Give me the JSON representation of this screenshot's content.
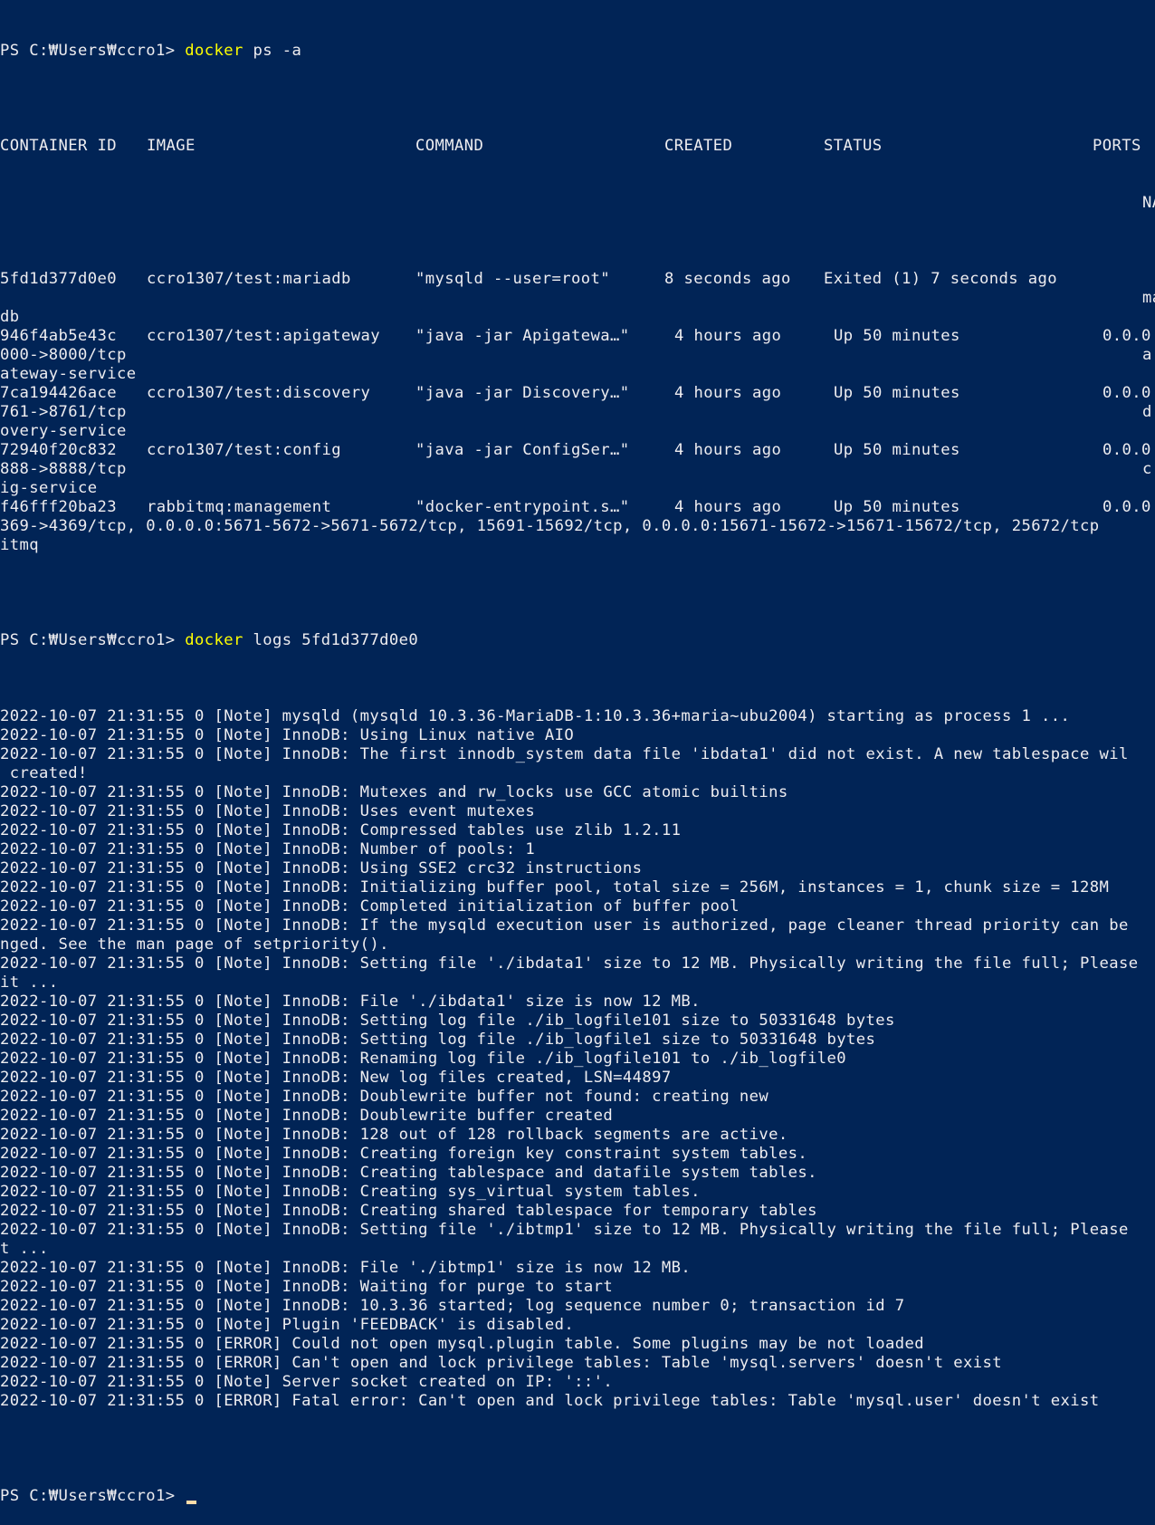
{
  "window": {
    "app": "Windows PowerShell",
    "colors": {
      "background": "#012456",
      "text": "#eeedf0",
      "command": "#ffff00",
      "cursor": "#fedba9"
    }
  },
  "prompt": "PS C:₩Users₩ccro1> ",
  "prev_command": {
    "prefix": "PS C:₩Users₩ccro1> ",
    "cmd": "docker",
    "args": " ps -a"
  },
  "docker_ps": {
    "headers": {
      "container_id": "CONTAINER ID",
      "image": "IMAGE",
      "command": "COMMAND",
      "created": "CREATED",
      "status": "STATUS",
      "ports": "PORTS",
      "names_partial": "NA"
    },
    "rows": [
      {
        "container_id": "5fd1d377d0e0",
        "image": "ccro1307/test:mariadb",
        "command": "\"mysqld --user=root\"",
        "created": "8 seconds ago",
        "status": "Exited (1) 7 seconds ago",
        "ports_partial": "",
        "wrap1": "",
        "wrap1_right": "ma",
        "wrap2": "db"
      },
      {
        "container_id": "946f4ab5e43c",
        "image": "ccro1307/test:apigateway",
        "command": "\"java -jar Apigatewa…\"",
        "created": "4 hours ago",
        "status": "Up 50 minutes",
        "ports_partial": "0.0.0",
        "wrap1": "000->8000/tcp",
        "wrap1_right": "a",
        "wrap2": "ateway-service"
      },
      {
        "container_id": "7ca194426ace",
        "image": "ccro1307/test:discovery",
        "command": "\"java -jar Discovery…\"",
        "created": "4 hours ago",
        "status": "Up 50 minutes",
        "ports_partial": "0.0.0",
        "wrap1": "761->8761/tcp",
        "wrap1_right": "d",
        "wrap2": "overy-service"
      },
      {
        "container_id": "72940f20c832",
        "image": "ccro1307/test:config",
        "command": "\"java -jar ConfigSer…\"",
        "created": "4 hours ago",
        "status": "Up 50 minutes",
        "ports_partial": "0.0.0",
        "wrap1": "888->8888/tcp",
        "wrap1_right": "c",
        "wrap2": "ig-service"
      },
      {
        "container_id": "f46fff20ba23",
        "image": "rabbitmq:management",
        "command": "\"docker-entrypoint.s…\"",
        "created": "4 hours ago",
        "status": "Up 50 minutes",
        "ports_partial": "0.0.0",
        "wrap1": "369->4369/tcp, 0.0.0.0:5671-5672->5671-5672/tcp, 15691-15692/tcp, 0.0.0.0:15671-15672->15671-15672/tcp, 25672/tcp",
        "wrap1_right": "",
        "wrap2": "itmq"
      }
    ]
  },
  "logs_command": {
    "prefix": "PS C:₩Users₩ccro1> ",
    "cmd": "docker",
    "args": " logs 5fd1d377d0e0"
  },
  "log_lines": [
    "2022-10-07 21:31:55 0 [Note] mysqld (mysqld 10.3.36-MariaDB-1:10.3.36+maria~ubu2004) starting as process 1 ...",
    "2022-10-07 21:31:55 0 [Note] InnoDB: Using Linux native AIO",
    "2022-10-07 21:31:55 0 [Note] InnoDB: The first innodb_system data file 'ibdata1' did not exist. A new tablespace wil",
    " created!",
    "2022-10-07 21:31:55 0 [Note] InnoDB: Mutexes and rw_locks use GCC atomic builtins",
    "2022-10-07 21:31:55 0 [Note] InnoDB: Uses event mutexes",
    "2022-10-07 21:31:55 0 [Note] InnoDB: Compressed tables use zlib 1.2.11",
    "2022-10-07 21:31:55 0 [Note] InnoDB: Number of pools: 1",
    "2022-10-07 21:31:55 0 [Note] InnoDB: Using SSE2 crc32 instructions",
    "2022-10-07 21:31:55 0 [Note] InnoDB: Initializing buffer pool, total size = 256M, instances = 1, chunk size = 128M",
    "2022-10-07 21:31:55 0 [Note] InnoDB: Completed initialization of buffer pool",
    "2022-10-07 21:31:55 0 [Note] InnoDB: If the mysqld execution user is authorized, page cleaner thread priority can be",
    "nged. See the man page of setpriority().",
    "2022-10-07 21:31:55 0 [Note] InnoDB: Setting file './ibdata1' size to 12 MB. Physically writing the file full; Please",
    "it ...",
    "2022-10-07 21:31:55 0 [Note] InnoDB: File './ibdata1' size is now 12 MB.",
    "2022-10-07 21:31:55 0 [Note] InnoDB: Setting log file ./ib_logfile101 size to 50331648 bytes",
    "2022-10-07 21:31:55 0 [Note] InnoDB: Setting log file ./ib_logfile1 size to 50331648 bytes",
    "2022-10-07 21:31:55 0 [Note] InnoDB: Renaming log file ./ib_logfile101 to ./ib_logfile0",
    "2022-10-07 21:31:55 0 [Note] InnoDB: New log files created, LSN=44897",
    "2022-10-07 21:31:55 0 [Note] InnoDB: Doublewrite buffer not found: creating new",
    "2022-10-07 21:31:55 0 [Note] InnoDB: Doublewrite buffer created",
    "2022-10-07 21:31:55 0 [Note] InnoDB: 128 out of 128 rollback segments are active.",
    "2022-10-07 21:31:55 0 [Note] InnoDB: Creating foreign key constraint system tables.",
    "2022-10-07 21:31:55 0 [Note] InnoDB: Creating tablespace and datafile system tables.",
    "2022-10-07 21:31:55 0 [Note] InnoDB: Creating sys_virtual system tables.",
    "2022-10-07 21:31:55 0 [Note] InnoDB: Creating shared tablespace for temporary tables",
    "2022-10-07 21:31:55 0 [Note] InnoDB: Setting file './ibtmp1' size to 12 MB. Physically writing the file full; Please",
    "t ...",
    "2022-10-07 21:31:55 0 [Note] InnoDB: File './ibtmp1' size is now 12 MB.",
    "2022-10-07 21:31:55 0 [Note] InnoDB: Waiting for purge to start",
    "2022-10-07 21:31:55 0 [Note] InnoDB: 10.3.36 started; log sequence number 0; transaction id 7",
    "2022-10-07 21:31:55 0 [Note] Plugin 'FEEDBACK' is disabled.",
    "2022-10-07 21:31:55 0 [ERROR] Could not open mysql.plugin table. Some plugins may be not loaded",
    "2022-10-07 21:31:55 0 [ERROR] Can't open and lock privilege tables: Table 'mysql.servers' doesn't exist",
    "2022-10-07 21:31:55 0 [Note] Server socket created on IP: '::'.",
    "2022-10-07 21:31:55 0 [ERROR] Fatal error: Can't open and lock privilege tables: Table 'mysql.user' doesn't exist"
  ]
}
